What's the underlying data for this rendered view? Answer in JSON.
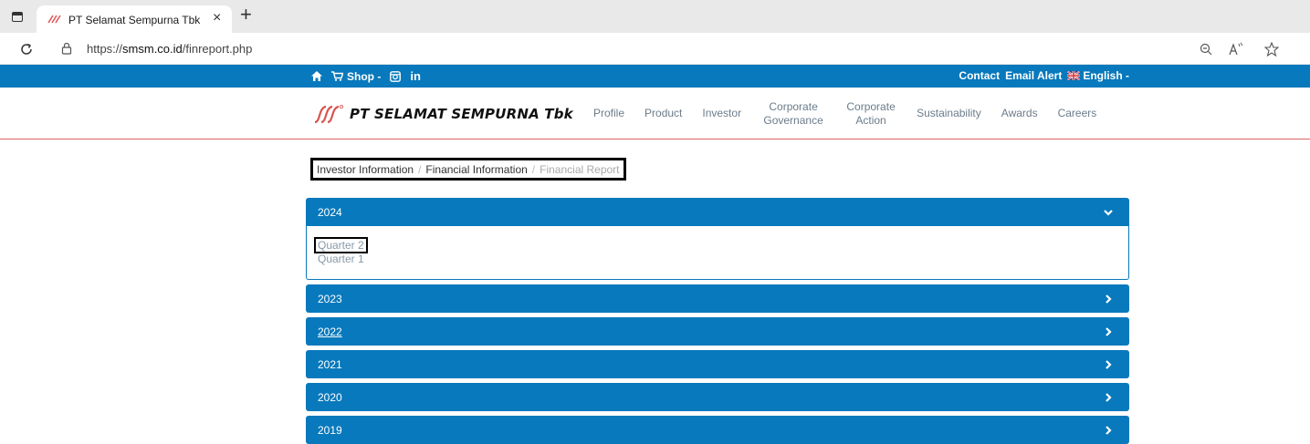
{
  "browser": {
    "tab_title": "PT Selamat Sempurna Tbk",
    "close_glyph": "×",
    "new_tab_glyph": "+",
    "url_prefix": "https://",
    "url_host": "smsm.co.id",
    "url_path": "/finreport.php",
    "icons": [
      "tab-actions-icon",
      "reload-icon",
      "lock-icon",
      "zoom-out-icon",
      "read-aloud-icon",
      "favorite-star-icon"
    ]
  },
  "topbar": {
    "shop_label": "Shop -",
    "linkedin_label": "in",
    "contact_label": "Contact",
    "email_alert_label": "Email Alert",
    "language_label": "English -"
  },
  "brand": {
    "name": "PT SELAMAT SEMPURNA Tbk",
    "reg_mark": "®"
  },
  "nav": [
    {
      "label": "Profile"
    },
    {
      "label": "Product"
    },
    {
      "label": "Investor"
    },
    {
      "label": "Corporate Governance"
    },
    {
      "label": "Corporate Action"
    },
    {
      "label": "Sustainability"
    },
    {
      "label": "Awards"
    },
    {
      "label": "Careers"
    }
  ],
  "breadcrumb": {
    "items": [
      "Investor Information",
      "Financial Information"
    ],
    "current": "Financial Report",
    "separator": "/"
  },
  "years": [
    {
      "label": "2024",
      "expanded": true,
      "quarters": [
        "Quarter 2",
        "Quarter 1"
      ]
    },
    {
      "label": "2023",
      "expanded": false
    },
    {
      "label": "2022",
      "expanded": false
    },
    {
      "label": "2021",
      "expanded": false
    },
    {
      "label": "2020",
      "expanded": false
    },
    {
      "label": "2019",
      "expanded": false
    }
  ],
  "colors": {
    "brand_blue": "#0879bc",
    "nav_text": "#6b7c8a",
    "divider_red": "#e06060"
  }
}
